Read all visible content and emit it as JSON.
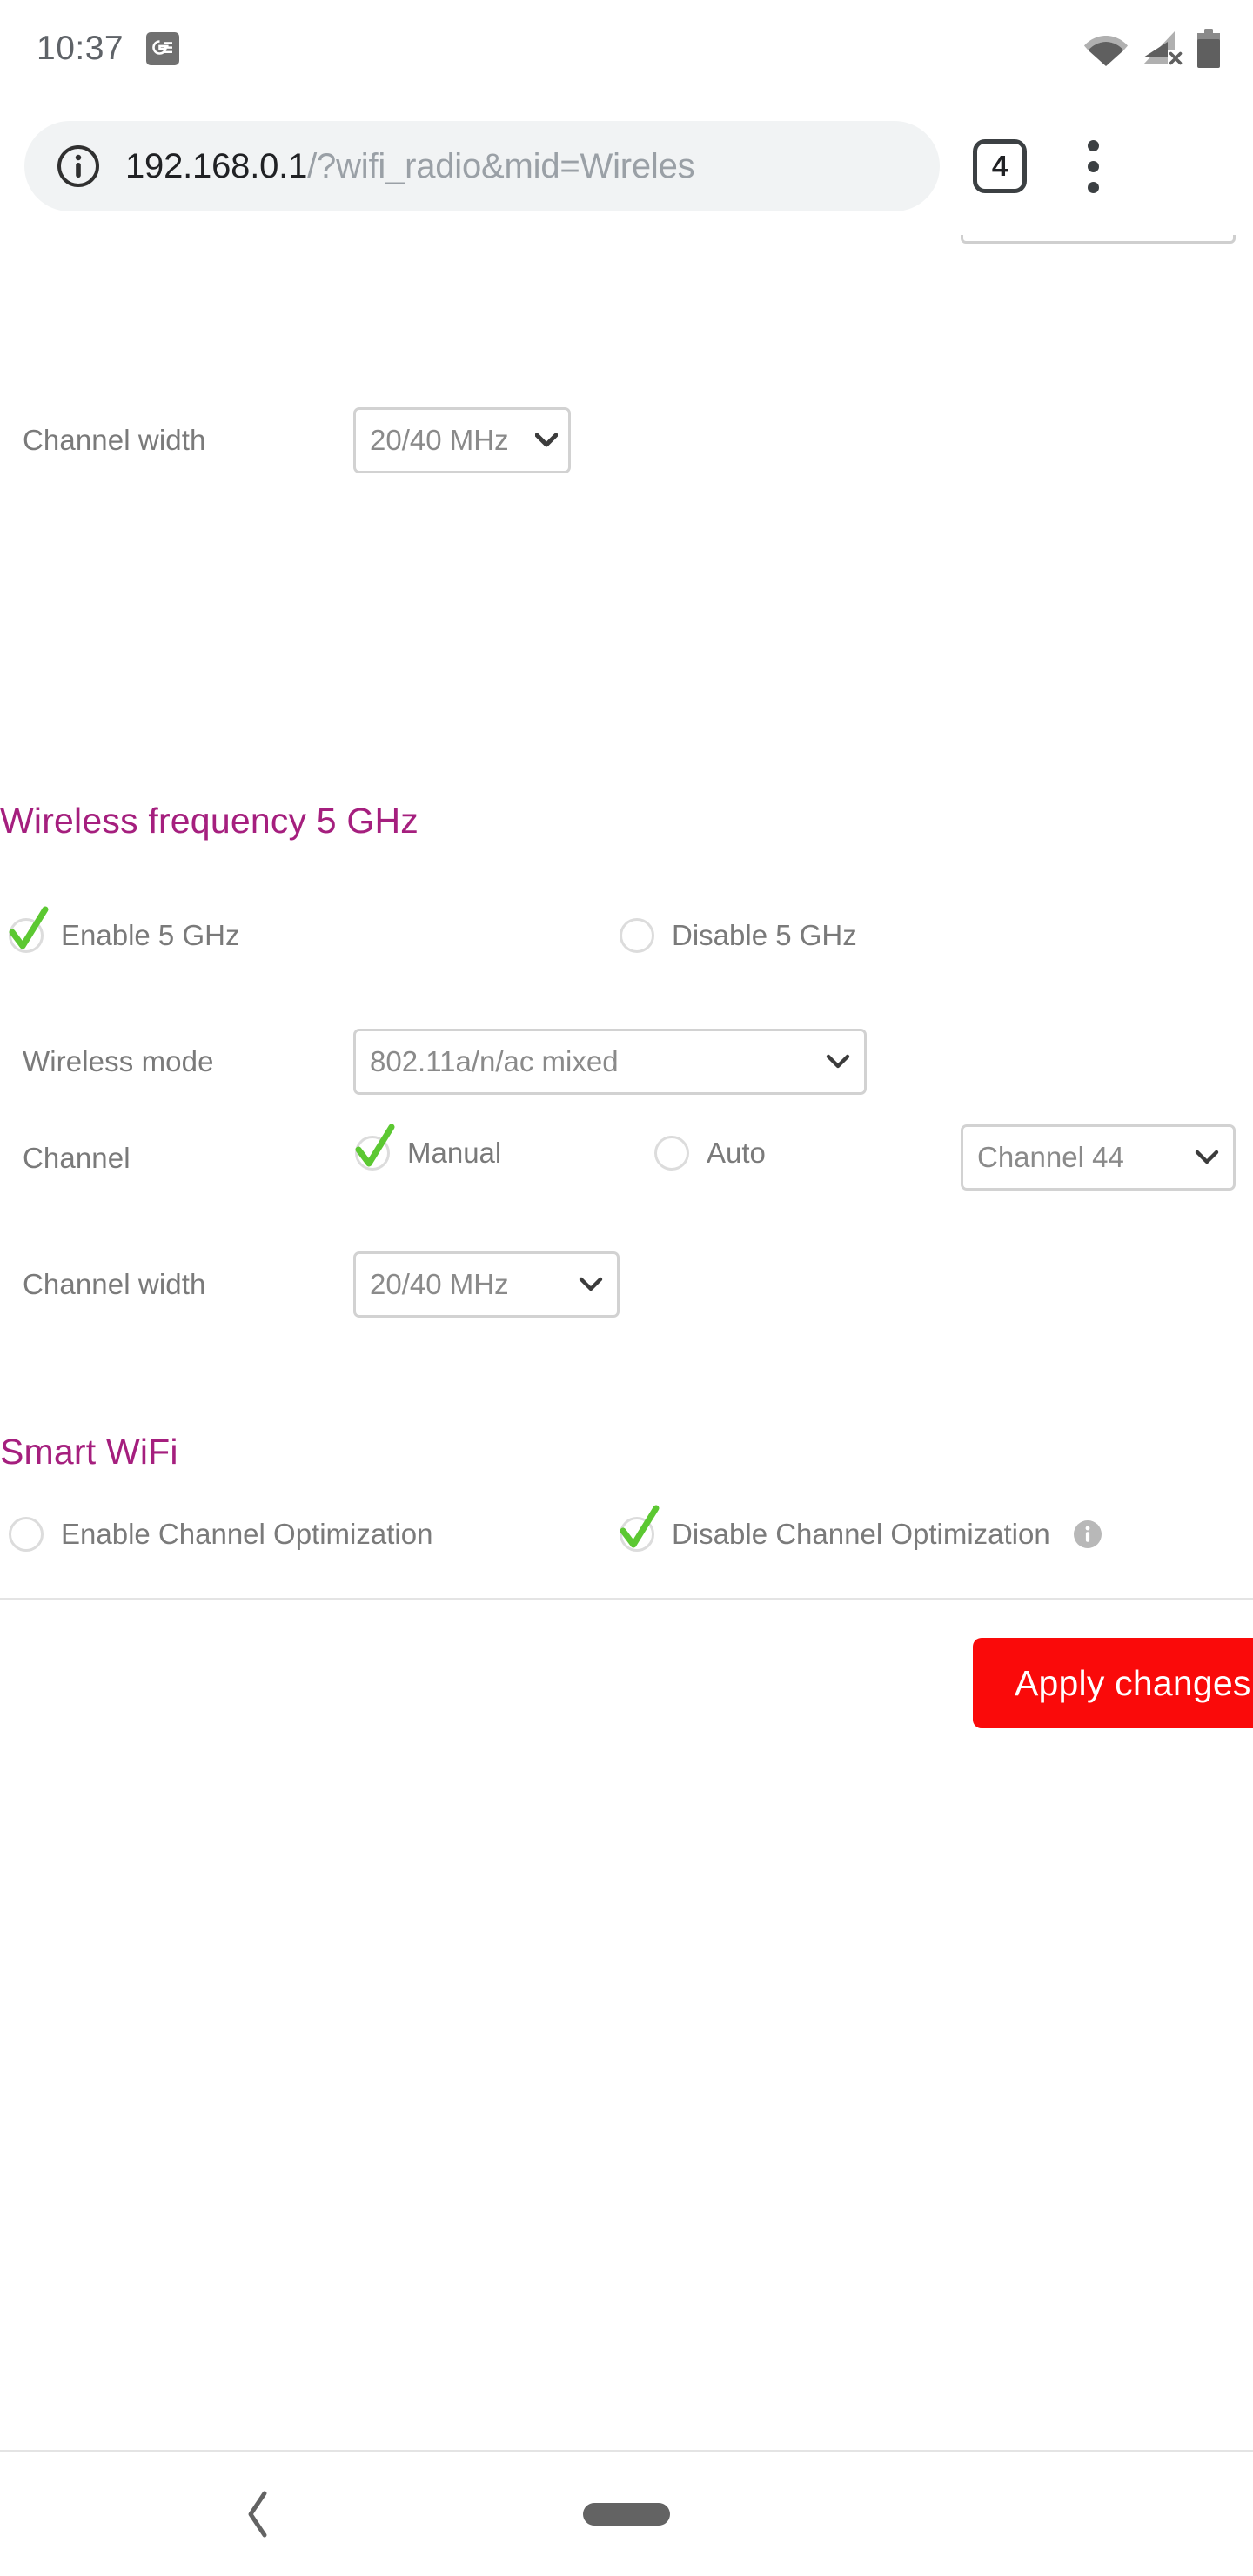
{
  "status_bar": {
    "time": "10:37",
    "news_icon": "google-news-icon",
    "wifi_icon": "wifi-icon",
    "cellular_icon": "cellular-no-sim-icon",
    "battery_icon": "battery-icon"
  },
  "browser": {
    "site_info_icon": "info-circle-icon",
    "url_host": "192.168.0.1",
    "url_path": "/?wifi_radio&mid=Wireles",
    "url_full": "192.168.0.1/?wifi_radio&mid=Wireles",
    "tab_count": "4",
    "menu_icon": "three-dot-menu-icon"
  },
  "page": {
    "top_partial_row": {
      "label": "Channel width",
      "value": "20/40 MHz"
    },
    "section_5ghz": {
      "heading": "Wireless frequency 5 GHz",
      "enable_label": "Enable 5 GHz",
      "enable_selected": true,
      "disable_label": "Disable 5 GHz",
      "disable_selected": false,
      "wireless_mode_label": "Wireless mode",
      "wireless_mode_value": "802.11a/n/ac mixed",
      "channel_label": "Channel",
      "channel_manual_label": "Manual",
      "channel_manual_selected": true,
      "channel_auto_label": "Auto",
      "channel_auto_selected": false,
      "channel_value": "Channel 44",
      "channel_width_label": "Channel width",
      "channel_width_value": "20/40 MHz"
    },
    "section_smart_wifi": {
      "heading": "Smart WiFi",
      "enable_label": "Enable Channel Optimization",
      "enable_selected": false,
      "disable_label": "Disable Channel Optimization",
      "disable_selected": true,
      "info_icon": "info-icon"
    },
    "apply_button_label": "Apply changes"
  },
  "nav_bar": {
    "back_icon": "back-chevron-icon",
    "home_pill": "home-pill-icon"
  },
  "colors": {
    "heading_magenta": "#a51f7e",
    "apply_red": "#fa0a0a",
    "check_green": "#5cc832",
    "label_grey": "#7a7a7a"
  }
}
